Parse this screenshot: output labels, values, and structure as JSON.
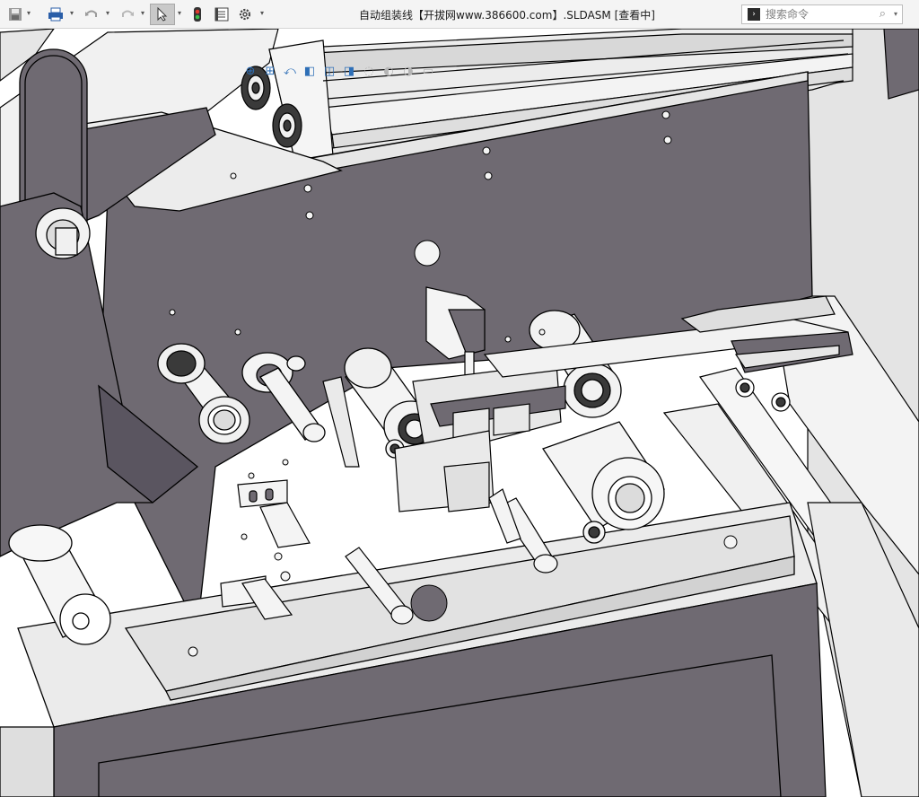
{
  "app": {
    "document_title": "自动组装线【开拔网www.386600.com】.SLDASM [查看中]"
  },
  "quick_access": {
    "tools": [
      {
        "name": "new-document",
        "glyph": "▭"
      },
      {
        "name": "save",
        "glyph": "💾"
      },
      {
        "name": "print",
        "glyph": "⎙"
      },
      {
        "name": "undo",
        "glyph": "↶"
      },
      {
        "name": "redo",
        "glyph": "↷"
      },
      {
        "name": "select",
        "glyph": "➚"
      },
      {
        "name": "rebuild",
        "glyph": "●"
      },
      {
        "name": "file-properties",
        "glyph": "▤"
      },
      {
        "name": "options",
        "glyph": "⚙"
      }
    ],
    "dropdown_glyph": "▾"
  },
  "search": {
    "placeholder": "搜索命令",
    "prompt_glyph": ">_",
    "mag_glyph": "⌕",
    "drop_glyph": "▾"
  },
  "heads_up_toolbar": {
    "buttons": [
      {
        "name": "zoom-to-fit",
        "glyph": "⊕"
      },
      {
        "name": "zoom-to-area",
        "glyph": "⊞"
      },
      {
        "name": "previous-view",
        "glyph": "⤺"
      },
      {
        "name": "section-view",
        "glyph": "◧"
      },
      {
        "name": "view-orientation",
        "glyph": "◫"
      },
      {
        "name": "display-style",
        "glyph": "◨"
      },
      {
        "name": "hide-show-items",
        "glyph": "◌"
      },
      {
        "name": "edit-appearance",
        "glyph": "◐"
      },
      {
        "name": "apply-scene",
        "glyph": "◑"
      },
      {
        "name": "view-settings",
        "glyph": "▭"
      }
    ]
  },
  "colors": {
    "plate": "#6f6a72",
    "plate_dark": "#5a5560",
    "plate_light": "#8a858c",
    "edge": "#000000",
    "metal_light": "#f2f2f2",
    "metal_mid": "#dcdcdc",
    "frame": "#e9e9e9",
    "accent_blue": "#2e6fb7"
  }
}
